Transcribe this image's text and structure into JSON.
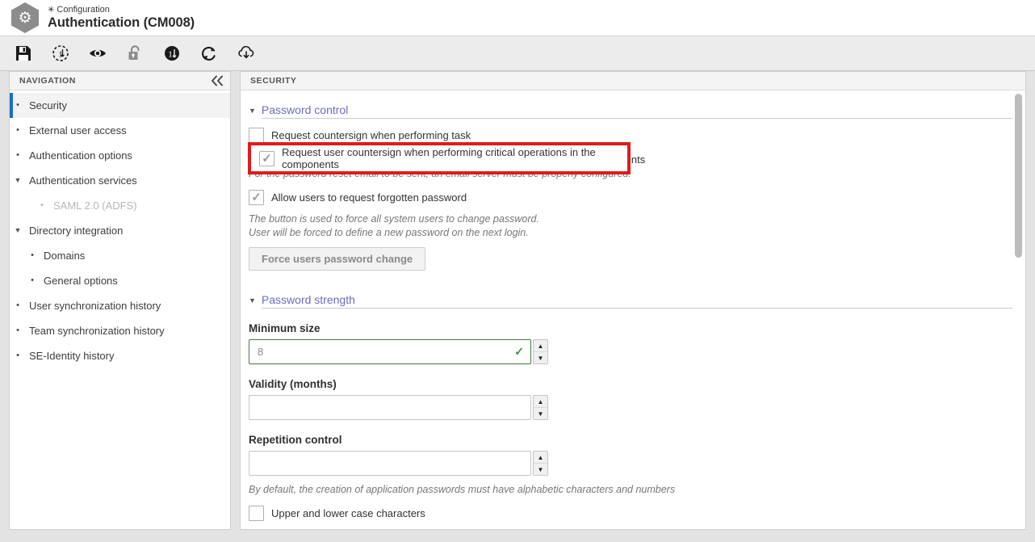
{
  "header": {
    "breadcrumb": "Configuration",
    "breadcrumb_icon": "gear-icon",
    "title": "Authentication (CM008)",
    "logo_icon": "gear-hexagon-logo"
  },
  "toolbar": {
    "buttons": [
      {
        "name": "save-icon",
        "title": "Save"
      },
      {
        "name": "revision-dashed-icon",
        "title": "Revision"
      },
      {
        "name": "eye-icon",
        "title": "View"
      },
      {
        "name": "unlock-icon",
        "title": "Unlock"
      },
      {
        "name": "revision-filled-icon",
        "title": "Revision filled"
      },
      {
        "name": "refresh-icon",
        "title": "Refresh"
      },
      {
        "name": "cloud-download-icon",
        "title": "Cloud download"
      }
    ]
  },
  "navigation": {
    "panel_title": "NAVIGATION",
    "collapse_icon": "chevron-double-left-icon",
    "items": [
      {
        "label": "Security",
        "level": 0,
        "marker": "bullet",
        "active": true,
        "dim": false
      },
      {
        "label": "External user access",
        "level": 0,
        "marker": "bullet",
        "active": false,
        "dim": false
      },
      {
        "label": "Authentication options",
        "level": 0,
        "marker": "bullet",
        "active": false,
        "dim": false
      },
      {
        "label": "Authentication services",
        "level": 0,
        "marker": "caret",
        "active": false,
        "dim": false
      },
      {
        "label": "SAML 2.0 (ADFS)",
        "level": 2,
        "marker": "bullet",
        "active": false,
        "dim": true
      },
      {
        "label": "Directory integration",
        "level": 0,
        "marker": "caret",
        "active": false,
        "dim": false
      },
      {
        "label": "Domains",
        "level": 1,
        "marker": "bullet",
        "active": false,
        "dim": false
      },
      {
        "label": "General options",
        "level": 1,
        "marker": "bullet",
        "active": false,
        "dim": false
      },
      {
        "label": "User synchronization history",
        "level": 0,
        "marker": "bullet",
        "active": false,
        "dim": false
      },
      {
        "label": "Team synchronization history",
        "level": 0,
        "marker": "bullet",
        "active": false,
        "dim": false
      },
      {
        "label": "SE-Identity history",
        "level": 0,
        "marker": "bullet",
        "active": false,
        "dim": false
      }
    ]
  },
  "content": {
    "panel_title": "SECURITY",
    "password_control": {
      "section_title": "Password control",
      "checkbox_countersign_task": "Request countersign when performing task",
      "checkbox_countersign_critical": "Request user countersign when performing critical operations in the components",
      "hint_email_server": "For the password reset email to be sent, an email server must be properly configured.",
      "checkbox_forgotten_password": "Allow users to request forgotten password",
      "hint_force_line1": "The button is used to force all system users to change password.",
      "hint_force_line2": "User will be forced to define a new password on the next login.",
      "force_button": "Force users password change"
    },
    "password_strength": {
      "section_title": "Password strength",
      "minimum_size_label": "Minimum size",
      "minimum_size_value": "8",
      "validity_label": "Validity (months)",
      "validity_value": "",
      "repetition_label": "Repetition control",
      "repetition_value": "",
      "hint_alphabetic": "By default, the creation of application passwords must have alphabetic characters and numbers",
      "checkbox_upper_lower": "Upper and lower case characters"
    }
  },
  "annotation": {
    "highlight_color": "#e01b1b",
    "highlighted_label": "Request user countersign when performing critical operations in the components"
  },
  "colors": {
    "accent_blue": "#1a6fc4",
    "section_link": "#6c6cc4",
    "valid_green": "#3f7d3f",
    "highlight_red": "#e01b1b"
  }
}
